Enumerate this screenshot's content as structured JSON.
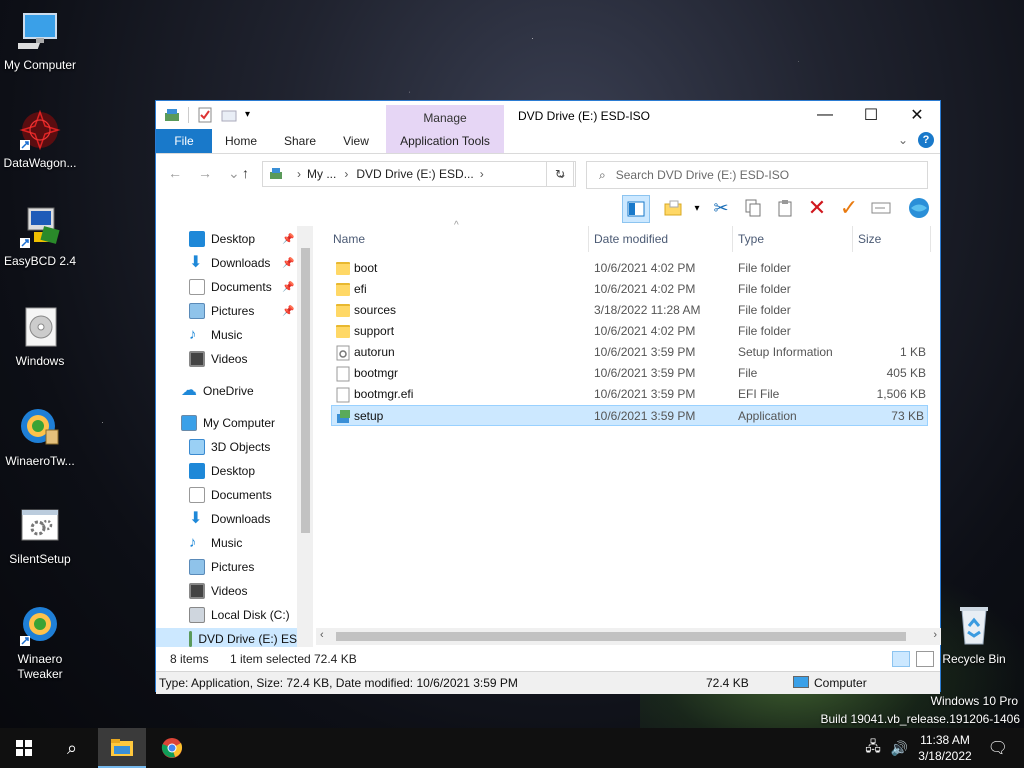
{
  "desktop": {
    "icons": [
      {
        "label": "My Computer"
      },
      {
        "label": "DataWagon..."
      },
      {
        "label": "EasyBCD 2.4"
      },
      {
        "label": "Windows"
      },
      {
        "label": "WinaeroTw..."
      },
      {
        "label": "SilentSetup"
      },
      {
        "label": "Winaero\nTweaker"
      },
      {
        "label": "Recycle Bin"
      }
    ],
    "watermark": {
      "line1": "Windows 10 Pro",
      "line2": "Build 19041.vb_release.191206-1406"
    }
  },
  "window": {
    "title": "DVD Drive (E:) ESD-ISO",
    "manage_tab": "Manage",
    "ribbon_tabs": {
      "file": "File",
      "home": "Home",
      "share": "Share",
      "view": "View",
      "app_tools": "Application Tools"
    },
    "address": {
      "part1": "My ...",
      "part2": "DVD Drive (E:) ESD..."
    },
    "search_placeholder": "Search DVD Drive (E:) ESD-ISO",
    "nav": {
      "quick": [
        {
          "label": "Desktop",
          "pinned": true
        },
        {
          "label": "Downloads",
          "pinned": true
        },
        {
          "label": "Documents",
          "pinned": true
        },
        {
          "label": "Pictures",
          "pinned": true
        },
        {
          "label": "Music"
        },
        {
          "label": "Videos"
        }
      ],
      "onedrive": "OneDrive",
      "this_pc": "My Computer",
      "pc_items": [
        "3D Objects",
        "Desktop",
        "Documents",
        "Downloads",
        "Music",
        "Pictures",
        "Videos",
        "Local Disk (C:)",
        "DVD Drive (E:) ES"
      ]
    },
    "columns": {
      "name": "Name",
      "date": "Date modified",
      "type": "Type",
      "size": "Size"
    },
    "files": [
      {
        "name": "boot",
        "date": "10/6/2021 4:02 PM",
        "type": "File folder",
        "size": "",
        "kind": "folder"
      },
      {
        "name": "efi",
        "date": "10/6/2021 4:02 PM",
        "type": "File folder",
        "size": "",
        "kind": "folder"
      },
      {
        "name": "sources",
        "date": "3/18/2022 11:28 AM",
        "type": "File folder",
        "size": "",
        "kind": "folder"
      },
      {
        "name": "support",
        "date": "10/6/2021 4:02 PM",
        "type": "File folder",
        "size": "",
        "kind": "folder"
      },
      {
        "name": "autorun",
        "date": "10/6/2021 3:59 PM",
        "type": "Setup Information",
        "size": "1 KB",
        "kind": "inf"
      },
      {
        "name": "bootmgr",
        "date": "10/6/2021 3:59 PM",
        "type": "File",
        "size": "405 KB",
        "kind": "file"
      },
      {
        "name": "bootmgr.efi",
        "date": "10/6/2021 3:59 PM",
        "type": "EFI File",
        "size": "1,506 KB",
        "kind": "file"
      },
      {
        "name": "setup",
        "date": "10/6/2021 3:59 PM",
        "type": "Application",
        "size": "73 KB",
        "kind": "app",
        "selected": true
      }
    ],
    "status": {
      "items": "8 items",
      "selected": "1 item selected",
      "sel_size": "72.4 KB"
    },
    "details": {
      "text": "Type: Application, Size: 72.4 KB, Date modified: 10/6/2021 3:59 PM",
      "size": "72.4 KB",
      "location": "Computer"
    }
  },
  "taskbar": {
    "time": "11:38 AM",
    "date": "3/18/2022"
  }
}
